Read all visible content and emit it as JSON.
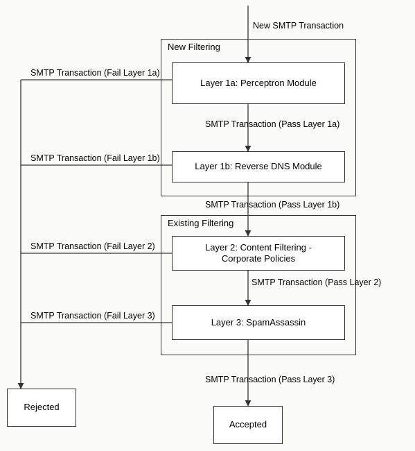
{
  "groups": {
    "new_filtering": "New Filtering",
    "existing_filtering": "Existing Filtering"
  },
  "nodes": {
    "layer1a": "Layer 1a: Perceptron Module",
    "layer1b": "Layer 1b: Reverse DNS Module",
    "layer2_line1": "Layer 2: Content Filtering -",
    "layer2_line2": "Corporate Policies",
    "layer3": "Layer 3: SpamAssassin",
    "rejected": "Rejected",
    "accepted": "Accepted"
  },
  "edges": {
    "input": "New SMTP Transaction",
    "pass1a": "SMTP Transaction (Pass Layer 1a)",
    "pass1b": "SMTP Transaction (Pass Layer 1b)",
    "pass2": "SMTP Transaction (Pass Layer 2)",
    "pass3": "SMTP Transaction (Pass Layer 3)",
    "fail1a": "SMTP Transaction (Fail Layer 1a)",
    "fail1b": "SMTP Transaction (Fail Layer 1b)",
    "fail2": "SMTP Transaction (Fail Layer 2)",
    "fail3": "SMTP Transaction (Fail Layer 3)"
  },
  "chart_data": {
    "type": "flowchart",
    "nodes": [
      {
        "id": "start",
        "kind": "input",
        "label": "New SMTP Transaction"
      },
      {
        "id": "layer1a",
        "kind": "process",
        "label": "Layer 1a: Perceptron Module",
        "group": "new_filtering"
      },
      {
        "id": "layer1b",
        "kind": "process",
        "label": "Layer 1b: Reverse DNS Module",
        "group": "new_filtering"
      },
      {
        "id": "layer2",
        "kind": "process",
        "label": "Layer 2: Content Filtering - Corporate Policies",
        "group": "existing_filtering"
      },
      {
        "id": "layer3",
        "kind": "process",
        "label": "Layer 3: SpamAssassin",
        "group": "existing_filtering"
      },
      {
        "id": "rejected",
        "kind": "terminal",
        "label": "Rejected"
      },
      {
        "id": "accepted",
        "kind": "terminal",
        "label": "Accepted"
      }
    ],
    "groups": [
      {
        "id": "new_filtering",
        "label": "New Filtering"
      },
      {
        "id": "existing_filtering",
        "label": "Existing Filtering"
      }
    ],
    "edges": [
      {
        "from": "start",
        "to": "layer1a",
        "label": "New SMTP Transaction"
      },
      {
        "from": "layer1a",
        "to": "layer1b",
        "label": "SMTP Transaction (Pass Layer 1a)"
      },
      {
        "from": "layer1b",
        "to": "layer2",
        "label": "SMTP Transaction (Pass Layer 1b)"
      },
      {
        "from": "layer2",
        "to": "layer3",
        "label": "SMTP Transaction (Pass Layer 2)"
      },
      {
        "from": "layer3",
        "to": "accepted",
        "label": "SMTP Transaction (Pass Layer 3)"
      },
      {
        "from": "layer1a",
        "to": "rejected",
        "label": "SMTP Transaction (Fail Layer 1a)"
      },
      {
        "from": "layer1b",
        "to": "rejected",
        "label": "SMTP Transaction (Fail Layer 1b)"
      },
      {
        "from": "layer2",
        "to": "rejected",
        "label": "SMTP Transaction (Fail Layer 2)"
      },
      {
        "from": "layer3",
        "to": "rejected",
        "label": "SMTP Transaction (Fail Layer 3)"
      }
    ]
  }
}
